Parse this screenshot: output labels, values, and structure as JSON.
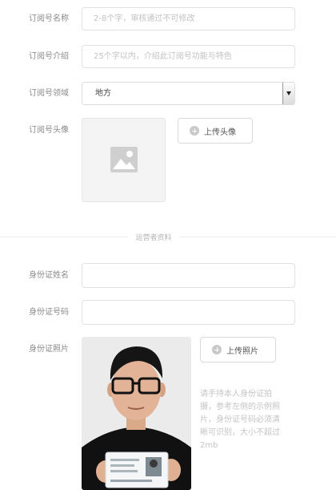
{
  "subscription": {
    "name_label": "订阅号名称",
    "name_placeholder": "2-8个字，审核通过不可修改",
    "intro_label": "订阅号介绍",
    "intro_placeholder": "25个字以内，介绍此订阅号功能与特色",
    "domain_label": "订阅号领域",
    "domain_value": "地方",
    "avatar_label": "订阅号头像",
    "avatar_upload_button": "上传头像"
  },
  "operator_section_title": "运营者资料",
  "operator": {
    "id_name_label": "身份证姓名",
    "id_number_label": "身份证号码",
    "id_photo_label": "身份证照片",
    "photo_upload_button": "上传照片",
    "photo_hint": "请手持本人身份证拍摄，参考左侧的示例照片，身份证号码必须清晰可识别，大小不超过 2mb"
  },
  "colors": {
    "border": "#e1e1e1",
    "placeholder": "#c2c2c2",
    "label": "#8a8a8a"
  }
}
